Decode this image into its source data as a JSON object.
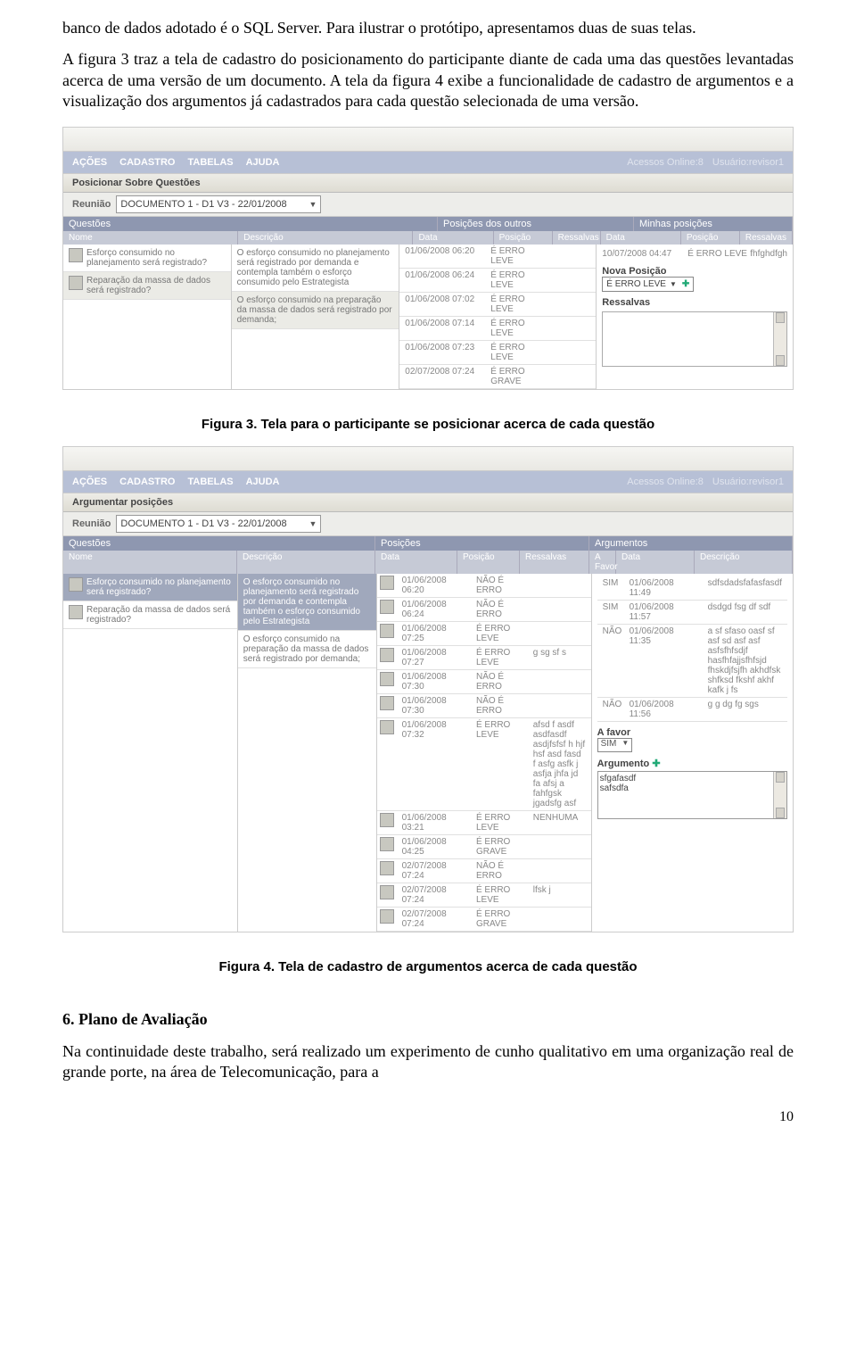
{
  "intro": {
    "p1": "banco de dados adotado é o SQL Server. Para ilustrar o protótipo, apresentamos duas de suas telas.",
    "p2": "A figura 3 traz a tela de cadastro do posicionamento do participante diante de cada uma das questões levantadas acerca de uma versão de um documento. A tela da figura 4 exibe a funcionalidade de cadastro de argumentos e a visualização dos argumentos já cadastrados para cada questão selecionada de uma versão."
  },
  "nav": {
    "acoes": "AÇÕES",
    "cadastro": "CADASTRO",
    "tabelas": "TABELAS",
    "ajuda": "AJUDA",
    "acessos_label": "Acessos Online:",
    "acessos_val": "8",
    "usuario_label": "Usuário:",
    "usuario_val": "revisor1"
  },
  "fig3": {
    "title": "Posicionar Sobre Questões",
    "reuniao_label": "Reunião",
    "reuniao_value": "DOCUMENTO 1 - D1 V3 - 22/01/2008",
    "h": {
      "questoes": "Questões",
      "posout": "Posições dos outros",
      "minhas": "Minhas posições",
      "nome": "Nome",
      "descricao": "Descrição",
      "data": "Data",
      "posicao": "Posição",
      "ressalvas": "Ressalvas"
    },
    "q": [
      {
        "nome": "Esforço consumido no planejamento será registrado?",
        "desc": "O esforço consumido no planejamento será registrado por demanda e contempla também o esforço consumido pelo Estrategista"
      },
      {
        "nome": "Reparação da massa de dados será registrado?",
        "desc": "O esforço consumido na preparação da massa de dados será registrado por demanda;"
      }
    ],
    "po": [
      {
        "data": "01/06/2008 06:20",
        "pos": "É ERRO LEVE",
        "res": ""
      },
      {
        "data": "01/06/2008 06:24",
        "pos": "É ERRO LEVE",
        "res": ""
      },
      {
        "data": "01/06/2008 07:02",
        "pos": "É ERRO LEVE",
        "res": ""
      },
      {
        "data": "01/06/2008 07:14",
        "pos": "É ERRO LEVE",
        "res": ""
      },
      {
        "data": "01/06/2008 07:23",
        "pos": "É ERRO LEVE",
        "res": ""
      },
      {
        "data": "02/07/2008 07:24",
        "pos": "É ERRO GRAVE",
        "res": ""
      }
    ],
    "mp": {
      "data": "10/07/2008 04:47",
      "pos": "É ERRO LEVE",
      "res": "fhfghdfgh"
    },
    "nova_label": "Nova Posição",
    "nova_value": "É ERRO LEVE",
    "ressalvas_label": "Ressalvas"
  },
  "caption3": "Figura 3. Tela para o participante se posicionar acerca de cada questão",
  "fig4": {
    "title": "Argumentar posições",
    "reuniao_label": "Reunião",
    "reuniao_value": "DOCUMENTO 1 - D1 V3 - 22/01/2008",
    "h": {
      "questoes": "Questões",
      "posicoes": "Posições",
      "arg": "Argumentos",
      "nome": "Nome",
      "descricao": "Descrição",
      "data": "Data",
      "posicao": "Posição",
      "ressalvas": "Ressalvas",
      "afavor": "A Favor",
      "adata": "Data",
      "adesc": "Descrição"
    },
    "q": [
      {
        "nome": "Esforço consumido no planejamento será registrado?",
        "desc": "O esforço consumido no planejamento será registrado por demanda e contempla também o esforço consumido pelo Estrategista"
      },
      {
        "nome": "Reparação da massa de dados será registrado?",
        "desc": "O esforço consumido na preparação da massa de dados será registrado por demanda;"
      }
    ],
    "po": [
      {
        "data": "01/06/2008 06:20",
        "pos": "NÃO É ERRO",
        "res": ""
      },
      {
        "data": "01/06/2008 06:24",
        "pos": "NÃO É ERRO",
        "res": ""
      },
      {
        "data": "01/06/2008 07:25",
        "pos": "É ERRO LEVE",
        "res": ""
      },
      {
        "data": "01/06/2008 07:27",
        "pos": "É ERRO LEVE",
        "res": "g sg sf s"
      },
      {
        "data": "01/06/2008 07:30",
        "pos": "NÃO É ERRO",
        "res": ""
      },
      {
        "data": "01/06/2008 07:30",
        "pos": "NÃO É ERRO",
        "res": ""
      },
      {
        "data": "01/06/2008 07:32",
        "pos": "É ERRO LEVE",
        "res": "afsd f asdf asdfasdf asdjfsfsf h hjf hsf asd fasd f asfg asfk j asfja jhfa jd fa afsj a fahfgsk jgadsfg asf"
      },
      {
        "data": "01/06/2008 03:21",
        "pos": "É ERRO LEVE",
        "res": "NENHUMA"
      },
      {
        "data": "01/06/2008 04:25",
        "pos": "É ERRO GRAVE",
        "res": ""
      },
      {
        "data": "02/07/2008 07:24",
        "pos": "NÃO É ERRO",
        "res": ""
      },
      {
        "data": "02/07/2008 07:24",
        "pos": "É ERRO LEVE",
        "res": "lfsk j"
      },
      {
        "data": "02/07/2008 07:24",
        "pos": "É ERRO GRAVE",
        "res": ""
      }
    ],
    "args": [
      {
        "af": "SIM",
        "data": "01/06/2008 11:49",
        "desc": "sdfsdadsfafasfasdf"
      },
      {
        "af": "SIM",
        "data": "01/06/2008 11:57",
        "desc": "dsdgd fsg df sdf"
      },
      {
        "af": "NÃO",
        "data": "01/06/2008 11:35",
        "desc": "a sf sfaso oasf sf asf sd asf asf asfsfhfsdjf hasfhfajjsfhfsjd fhskdjfsjfh akhdfsk shfksd fkshf akhf kafk j fs"
      },
      {
        "af": "NÃO",
        "data": "01/06/2008 11:56",
        "desc": "g g dg fg sgs"
      }
    ],
    "afavor_label": "A favor",
    "afavor_value": "SIM",
    "argumento_label": "Argumento",
    "argumento_value": "sfgafasdf\nsafsdfa"
  },
  "caption4": "Figura 4. Tela de cadastro de argumentos acerca de cada questão",
  "section6": {
    "head": "6. Plano de Avaliação",
    "p": "Na continuidade deste trabalho, será realizado um experimento de cunho qualitativo em uma organização real de grande porte, na área de Telecomunicação, para a"
  },
  "pagenum": "10"
}
